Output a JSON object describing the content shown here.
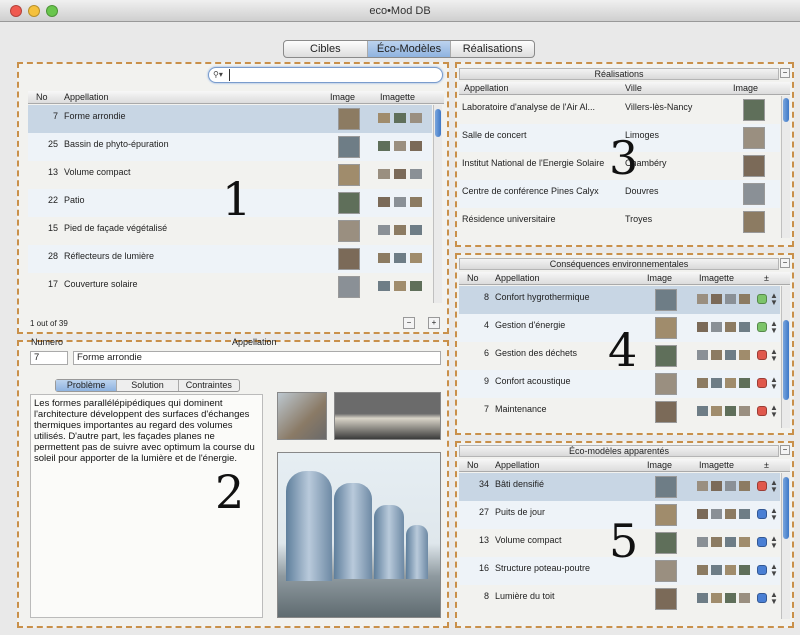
{
  "window": {
    "title": "eco•Mod DB"
  },
  "tabs": [
    "Cibles",
    "Éco-Modèles",
    "Réalisations"
  ],
  "panel1": {
    "number": "1",
    "search_placeholder": "",
    "columns": [
      "No",
      "Appellation",
      "Image",
      "Imagette"
    ],
    "rows": [
      {
        "no": "7",
        "name": "Forme arrondie"
      },
      {
        "no": "25",
        "name": "Bassin de phyto-épuration"
      },
      {
        "no": "13",
        "name": "Volume compact"
      },
      {
        "no": "22",
        "name": "Patio"
      },
      {
        "no": "15",
        "name": "Pied de façade végétalisé"
      },
      {
        "no": "28",
        "name": "Réflecteurs de lumière"
      },
      {
        "no": "17",
        "name": "Couverture solaire"
      }
    ],
    "count": "1 out of 39"
  },
  "panel2": {
    "number": "2",
    "numero_label": "Numero",
    "appellation_label": "Appellation",
    "numero_value": "7",
    "appellation_value": "Forme arrondie",
    "tabs": [
      "Problème",
      "Solution",
      "Contraintes"
    ],
    "description": "Les formes parallélépipédiques qui dominent l'architecture développent des surfaces d'échanges thermiques importantes au regard des volumes utilisés. D'autre part, les façades planes ne permettent pas de suivre avec optimum la course du soleil pour apporter de la lumière et de l'énergie."
  },
  "panel3": {
    "number": "3",
    "header": "Réalisations",
    "columns": [
      "Appellation",
      "Ville",
      "Image"
    ],
    "rows": [
      {
        "name": "Laboratoire d'analyse de l'Air Al...",
        "city": "Villers-lès-Nancy"
      },
      {
        "name": "Salle de concert",
        "city": "Limoges"
      },
      {
        "name": "Institut National de l'Energie Solaire",
        "city": "Chambéry"
      },
      {
        "name": "Centre de conférence Pines Calyx",
        "city": "Douvres"
      },
      {
        "name": "Résidence universitaire",
        "city": "Troyes"
      }
    ]
  },
  "panel4": {
    "number": "4",
    "header": "Conséquences environnementales",
    "columns": [
      "No",
      "Appellation",
      "Image",
      "Imagette",
      "±"
    ],
    "rows": [
      {
        "no": "8",
        "name": "Confort hygrothermique",
        "status": "#7cc46a"
      },
      {
        "no": "4",
        "name": "Gestion d'énergie",
        "status": "#7cc46a"
      },
      {
        "no": "6",
        "name": "Gestion des déchets",
        "status": "#e0584c"
      },
      {
        "no": "9",
        "name": "Confort acoustique",
        "status": "#e0584c"
      },
      {
        "no": "7",
        "name": "Maintenance",
        "status": "#e0584c"
      }
    ]
  },
  "panel5": {
    "number": "5",
    "header": "Éco-modèles apparentés",
    "columns": [
      "No",
      "Appellation",
      "Image",
      "Imagette",
      "±"
    ],
    "rows": [
      {
        "no": "34",
        "name": "Bâti densifié",
        "status": "#e0584c"
      },
      {
        "no": "27",
        "name": "Puits de jour",
        "status": "#4a7fd4"
      },
      {
        "no": "13",
        "name": "Volume compact",
        "status": "#4a7fd4"
      },
      {
        "no": "16",
        "name": "Structure poteau-poutre",
        "status": "#4a7fd4"
      },
      {
        "no": "8",
        "name": "Lumière du toit",
        "status": "#4a7fd4"
      }
    ]
  }
}
